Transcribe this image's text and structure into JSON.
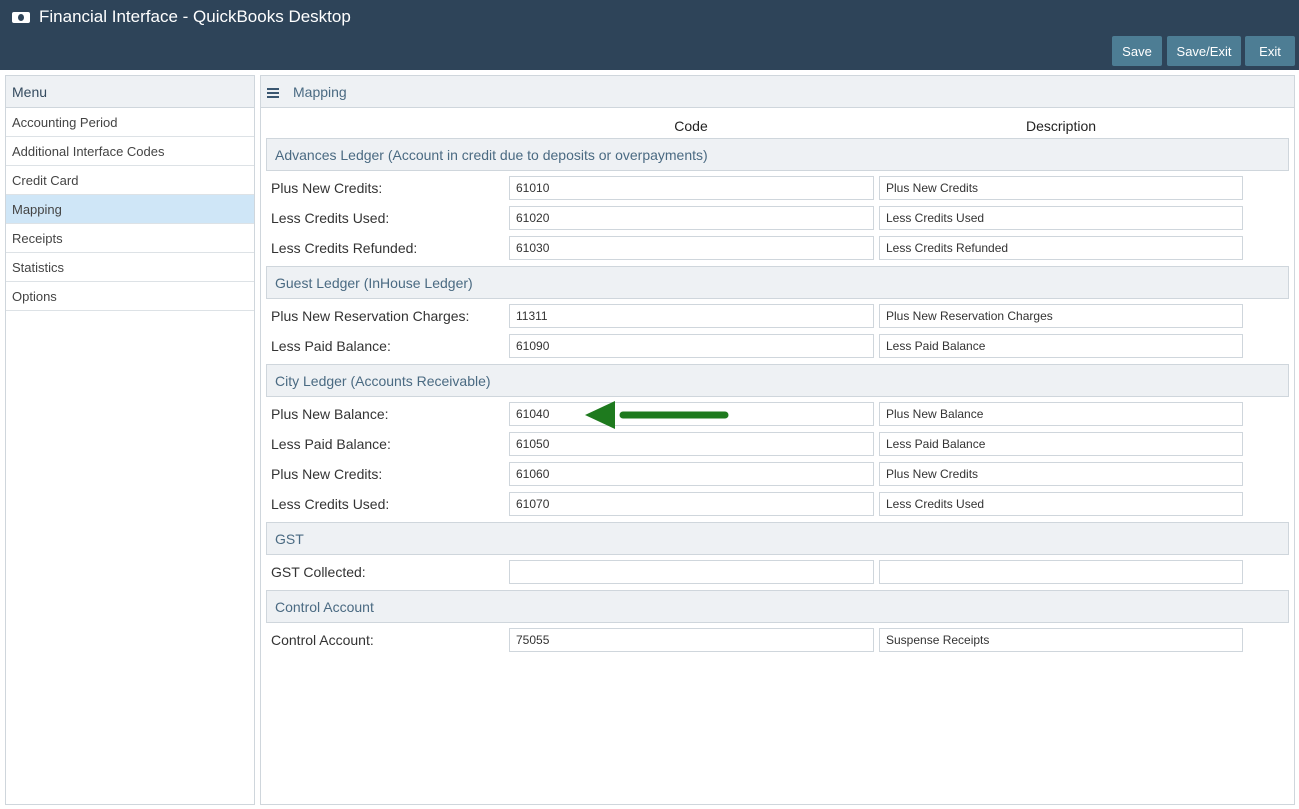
{
  "app": {
    "title": "Financial Interface - QuickBooks Desktop"
  },
  "toolbar": {
    "save_label": "Save",
    "save_exit_label": "Save/Exit",
    "exit_label": "Exit"
  },
  "sidebar": {
    "header": "Menu",
    "items": [
      {
        "label": "Accounting Period"
      },
      {
        "label": "Additional Interface Codes"
      },
      {
        "label": "Credit Card"
      },
      {
        "label": "Mapping",
        "active": true
      },
      {
        "label": "Receipts"
      },
      {
        "label": "Statistics"
      },
      {
        "label": "Options"
      }
    ]
  },
  "main": {
    "header": "Mapping",
    "columns": {
      "code": "Code",
      "description": "Description"
    },
    "sections": [
      {
        "title": "Advances Ledger (Account in credit due to deposits or overpayments)",
        "rows": [
          {
            "label": "Plus New Credits:",
            "code": "61010",
            "description": "Plus New Credits"
          },
          {
            "label": "Less Credits Used:",
            "code": "61020",
            "description": "Less Credits Used"
          },
          {
            "label": "Less Credits Refunded:",
            "code": "61030",
            "description": "Less Credits Refunded"
          }
        ]
      },
      {
        "title": "Guest Ledger (InHouse Ledger)",
        "rows": [
          {
            "label": "Plus New Reservation Charges:",
            "code": "11311",
            "description": "Plus New Reservation Charges"
          },
          {
            "label": "Less Paid Balance:",
            "code": "61090",
            "description": "Less Paid Balance"
          }
        ]
      },
      {
        "title": "City Ledger (Accounts Receivable)",
        "rows": [
          {
            "label": "Plus New Balance:",
            "code": "61040",
            "description": "Plus New Balance"
          },
          {
            "label": "Less Paid Balance:",
            "code": "61050",
            "description": "Less Paid Balance"
          },
          {
            "label": "Plus New Credits:",
            "code": "61060",
            "description": "Plus New Credits"
          },
          {
            "label": "Less Credits Used:",
            "code": "61070",
            "description": "Less Credits Used"
          }
        ]
      },
      {
        "title": "GST",
        "rows": [
          {
            "label": "GST Collected:",
            "code": "",
            "description": ""
          }
        ]
      },
      {
        "title": "Control Account",
        "rows": [
          {
            "label": "Control Account:",
            "code": "75055",
            "description": "Suspense Receipts"
          }
        ]
      }
    ]
  },
  "colors": {
    "header_bg": "#2e4459",
    "button_bg": "#4d7d94",
    "active_menu_bg": "#cfe6f7",
    "annotation_arrow": "#1e7a1e"
  }
}
